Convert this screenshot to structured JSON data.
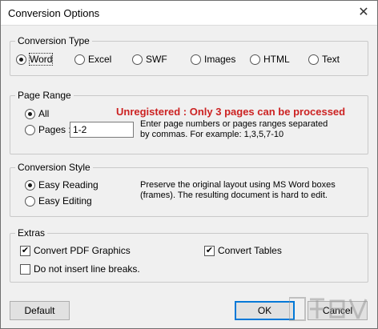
{
  "window": {
    "title": "Conversion Options"
  },
  "conversion_type": {
    "legend": "Conversion Type",
    "options": [
      {
        "label": "Word",
        "selected": true
      },
      {
        "label": "Excel",
        "selected": false
      },
      {
        "label": "SWF",
        "selected": false
      },
      {
        "label": "Images",
        "selected": false
      },
      {
        "label": "HTML",
        "selected": false
      },
      {
        "label": "Text",
        "selected": false
      }
    ]
  },
  "page_range": {
    "legend": "Page Range",
    "warning": "Unregistered : Only 3 pages can be processed",
    "all_label": "All",
    "pages_label": "Pages :",
    "pages_value": "1-2",
    "help_line1": "Enter page numbers or pages ranges separated",
    "help_line2": "by commas. For example: 1,3,5,7-10"
  },
  "conversion_style": {
    "legend": "Conversion Style",
    "easy_reading": "Easy Reading",
    "easy_editing": "Easy Editing",
    "help_line1": "Preserve the original layout using MS Word boxes",
    "help_line2": "(frames). The resulting document is hard to edit."
  },
  "extras": {
    "legend": "Extras",
    "convert_pdf_graphics": "Convert PDF  Graphics",
    "convert_tables": "Convert Tables",
    "no_line_breaks": "Do not insert line breaks."
  },
  "buttons": {
    "default": "Default",
    "ok": "OK",
    "cancel": "Cancel"
  },
  "colors": {
    "warning": "#cc2222",
    "default_button_border": "#0078d7"
  }
}
